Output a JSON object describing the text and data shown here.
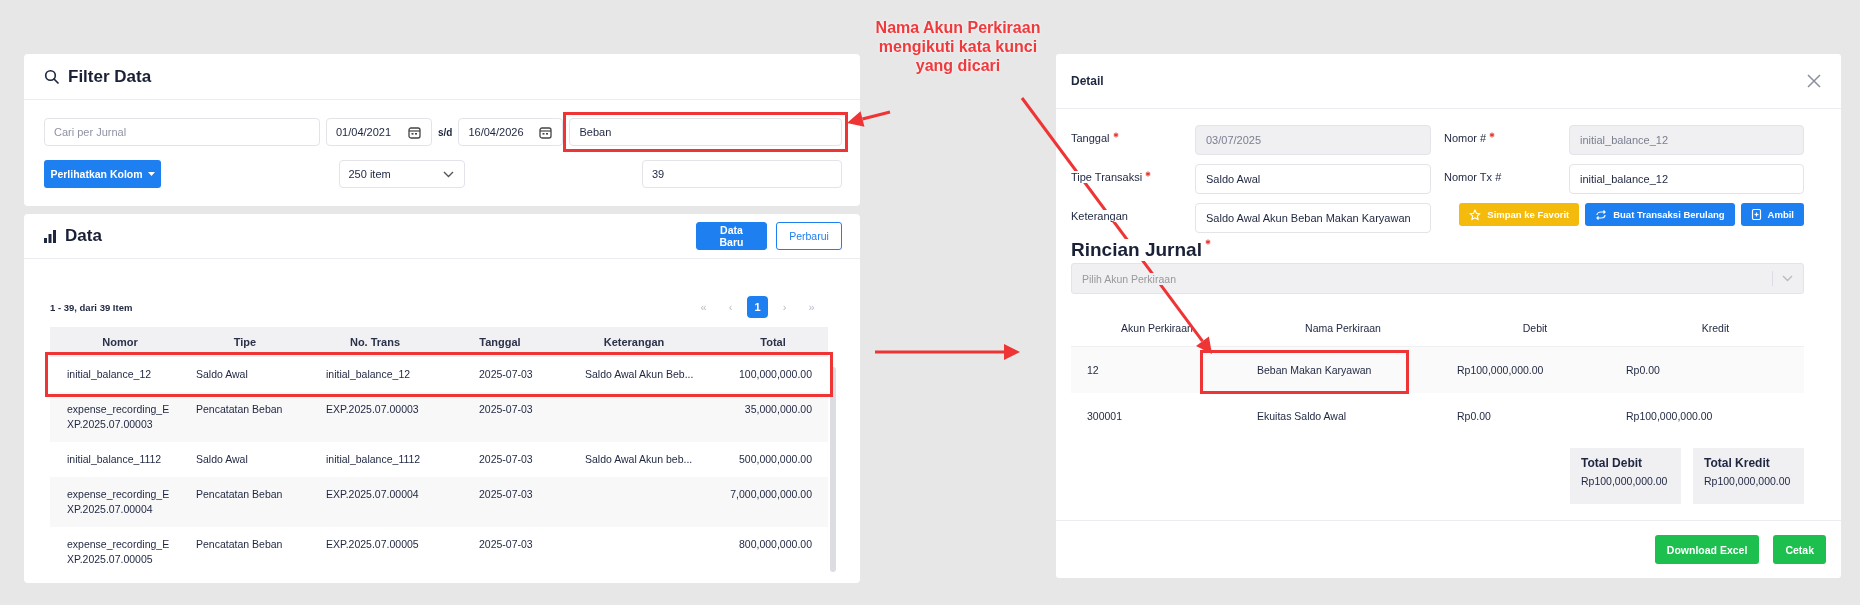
{
  "annotation": {
    "lines": [
      "Nama Akun Perkiraan",
      "mengikuti kata kunci",
      "yang dicari"
    ],
    "arrows": [
      {
        "kind": "to-keyword"
      },
      {
        "kind": "to-account-name"
      },
      {
        "kind": "to-detail"
      }
    ]
  },
  "filter": {
    "title": "Filter Data",
    "search": {
      "placeholder": "Cari per Jurnal"
    },
    "date_from": "01/04/2021",
    "range_separator": "s/d",
    "date_to": "16/04/2026",
    "keyword": {
      "value": "Beban",
      "highlighted": true
    },
    "columns_button": "Perlihatkan Kolom",
    "page_size": "250 item",
    "count": "39"
  },
  "data": {
    "title": "Data",
    "buttons": [
      {
        "label": "Data Baru",
        "kind": "primary"
      },
      {
        "label": "Perbarui",
        "kind": "outline"
      }
    ],
    "summary": "1 - 39, dari 39 Item",
    "pagination": [
      {
        "label": "«",
        "selected": false
      },
      {
        "label": "‹",
        "selected": false
      },
      {
        "label": "1",
        "selected": true
      },
      {
        "label": "›",
        "selected": false
      },
      {
        "label": "»",
        "selected": false
      }
    ],
    "table": {
      "columns": [
        "Nomor",
        "Tipe",
        "No. Trans",
        "Tanggal",
        "Keterangan",
        "Total"
      ],
      "rows": [
        {
          "cells": [
            "initial_balance_12",
            "Saldo Awal",
            "initial_balance_12",
            "2025-07-03",
            "Saldo Awal Akun Beb...",
            "100,000,000.00"
          ],
          "highlighted": true
        },
        {
          "cells": [
            "expense_recording_EXP.2025.07.00003",
            "Pencatatan Beban",
            "EXP.2025.07.00003",
            "2025-07-03",
            "",
            "35,000,000.00"
          ],
          "highlighted": false
        },
        {
          "cells": [
            "initial_balance_1112",
            "Saldo Awal",
            "initial_balance_1112",
            "2025-07-03",
            "Saldo Awal Akun beb...",
            "500,000,000.00"
          ],
          "highlighted": false
        },
        {
          "cells": [
            "expense_recording_EXP.2025.07.00004",
            "Pencatatan Beban",
            "EXP.2025.07.00004",
            "2025-07-03",
            "",
            "7,000,000,000.00"
          ],
          "highlighted": false
        },
        {
          "cells": [
            "expense_recording_EXP.2025.07.00005",
            "Pencatatan Beban",
            "EXP.2025.07.00005",
            "2025-07-03",
            "",
            "800,000,000.00"
          ],
          "highlighted": false
        }
      ]
    }
  },
  "detail": {
    "title": "Detail",
    "fields": [
      {
        "label": "Tanggal",
        "required": true,
        "value": "03/07/2025",
        "disabled": true
      },
      {
        "label": "Nomor #",
        "required": true,
        "value": "initial_balance_12",
        "disabled": true
      },
      {
        "label": "Tipe Transaksi",
        "required": true,
        "value": "Saldo Awal",
        "disabled": false
      },
      {
        "label": "Nomor Tx #",
        "required": false,
        "value": "initial_balance_12",
        "disabled": false
      },
      {
        "label": "Keterangan",
        "required": false,
        "value": "Saldo Awal Akun Beban Makan Karyawan",
        "disabled": false
      }
    ],
    "actions": [
      {
        "label": "Simpan ke Favorit",
        "kind": "warning"
      },
      {
        "label": "Buat Transaksi Berulang",
        "kind": "primary"
      },
      {
        "label": "Ambil",
        "kind": "primary"
      }
    ],
    "journal_title": "Rincian Jurnal",
    "journal_required": true,
    "account_select": {
      "placeholder": "Pilih Akun Perkiraan",
      "disabled": true
    },
    "journal": {
      "columns": [
        "Akun Perkiraan",
        "Nama Perkiraan",
        "Debit",
        "Kredit"
      ],
      "rows": [
        {
          "account": "12",
          "name": "Beban Makan Karyawan",
          "debit": "Rp100,000,000.00",
          "credit": "Rp0.00",
          "name_highlighted": true
        },
        {
          "account": "300001",
          "name": "Ekuitas Saldo Awal",
          "debit": "Rp0.00",
          "credit": "Rp100,000,000.00",
          "name_highlighted": false
        }
      ]
    },
    "totals": [
      {
        "label": "Total Debit",
        "value": "Rp100,000,000.00"
      },
      {
        "label": "Total Kredit",
        "value": "Rp100,000,000.00"
      }
    ],
    "footer_buttons": [
      {
        "label": "Download Excel"
      },
      {
        "label": "Cetak"
      }
    ]
  }
}
